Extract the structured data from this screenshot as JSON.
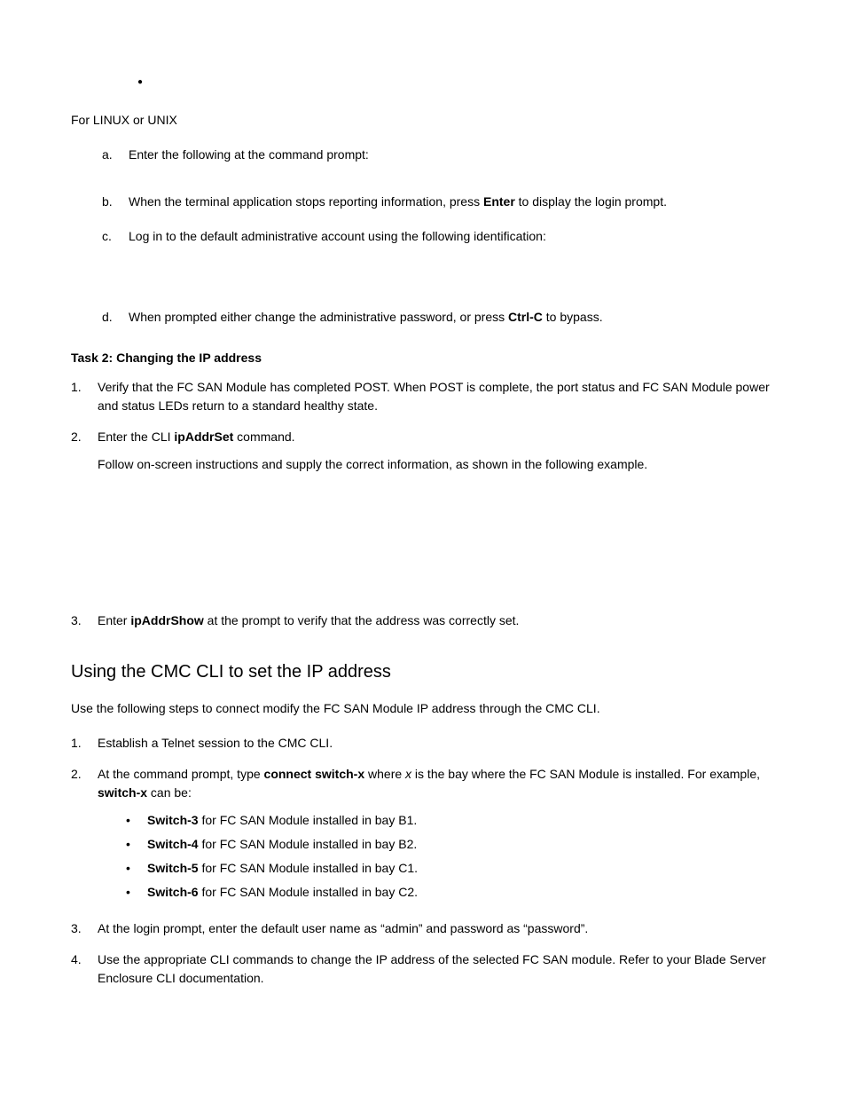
{
  "preamble": "For LINUX or UNIX",
  "steps": {
    "a": {
      "marker": "a.",
      "text": "Enter the following at the command prompt:"
    },
    "b": {
      "marker": "b.",
      "text1": "When the terminal application stops reporting information, press ",
      "bold": "Enter",
      "text2": " to display the login prompt."
    },
    "c": {
      "marker": "c.",
      "text": "Log in to the default administrative account using the following identification:"
    },
    "d": {
      "marker": "d.",
      "text1": "When prompted either change the administrative password, or press ",
      "bold": "Ctrl-C",
      "text2": " to bypass."
    }
  },
  "task2": {
    "heading": "Task 2: Changing the IP address",
    "one": {
      "marker": "1.",
      "text": "Verify that the FC SAN Module has completed POST. When POST is complete, the port status and FC SAN Module power and status LEDs return to a standard healthy state."
    },
    "two": {
      "marker": "2.",
      "text1": "Enter the CLI ",
      "bold": "ipAddrSet",
      "text2": " command.",
      "follow": "Follow on-screen instructions and supply the correct information, as shown in the following example."
    },
    "three": {
      "marker": "3.",
      "text1": "Enter ",
      "bold": "ipAddrShow",
      "text2": " at the prompt to verify that the address was correctly set."
    }
  },
  "section": {
    "heading": "Using the CMC CLI to set the IP address",
    "intro": "Use the following steps to connect modify the FC SAN Module IP address through the CMC CLI.",
    "one": {
      "marker": "1.",
      "text": "Establish a Telnet session to the CMC CLI."
    },
    "two": {
      "marker": "2.",
      "text1": "At the command prompt, type ",
      "bold1": "connect switch-x",
      "text2": " where ",
      "italic": "x",
      "text3": " is the bay where the FC SAN Module is installed. For example, ",
      "bold2": "switch-x",
      "text4": " can be:",
      "bullets": [
        {
          "bold": "Switch-3",
          "text": " for FC SAN Module installed in bay B1."
        },
        {
          "bold": "Switch-4",
          "text": " for FC SAN Module installed in bay B2."
        },
        {
          "bold": "Switch-5",
          "text": " for FC SAN Module installed in bay C1."
        },
        {
          "bold": "Switch-6",
          "text": " for FC SAN Module installed in bay C2."
        }
      ]
    },
    "three": {
      "marker": "3.",
      "text": "At the login prompt, enter the default user name as “admin” and password as “password”."
    },
    "four": {
      "marker": "4.",
      "text": "Use the appropriate CLI commands to change the IP address of the selected FC SAN module. Refer to your Blade Server Enclosure CLI documentation."
    }
  }
}
